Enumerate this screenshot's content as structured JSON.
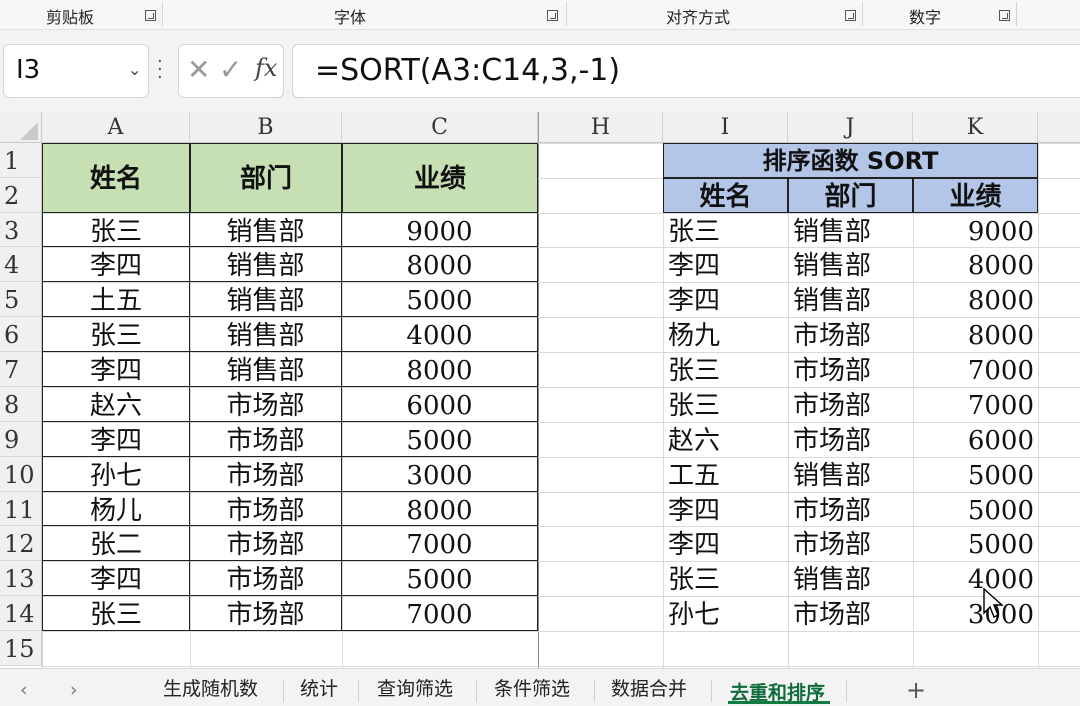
{
  "ribbon": {
    "groups": [
      "剪贴板",
      "字体",
      "对齐方式",
      "数字"
    ]
  },
  "formula_bar": {
    "name_box": "I3",
    "formula": "=SORT(A3:C14,3,-1)"
  },
  "columns": [
    "A",
    "B",
    "C",
    "H",
    "I",
    "J",
    "K"
  ],
  "rows": [
    "1",
    "2",
    "3",
    "4",
    "5",
    "6",
    "7",
    "8",
    "9",
    "10",
    "11",
    "12",
    "13",
    "14",
    "15"
  ],
  "left_table": {
    "headers": [
      "姓名",
      "部门",
      "业绩"
    ],
    "rows": [
      [
        "张三",
        "销售部",
        "9000"
      ],
      [
        "李四",
        "销售部",
        "8000"
      ],
      [
        "土五",
        "销售部",
        "5000"
      ],
      [
        "张三",
        "销售部",
        "4000"
      ],
      [
        "李四",
        "销售部",
        "8000"
      ],
      [
        "赵六",
        "市场部",
        "6000"
      ],
      [
        "李四",
        "市场部",
        "5000"
      ],
      [
        "孙七",
        "市场部",
        "3000"
      ],
      [
        "杨儿",
        "市场部",
        "8000"
      ],
      [
        "张二",
        "市场部",
        "7000"
      ],
      [
        "李四",
        "市场部",
        "5000"
      ],
      [
        "张三",
        "市场部",
        "7000"
      ]
    ]
  },
  "right_table": {
    "title": "排序函数 SORT",
    "headers": [
      "姓名",
      "部门",
      "业绩"
    ],
    "rows": [
      [
        "张三",
        "销售部",
        "9000"
      ],
      [
        "李四",
        "销售部",
        "8000"
      ],
      [
        "李四",
        "销售部",
        "8000"
      ],
      [
        "杨九",
        "市场部",
        "8000"
      ],
      [
        "张三",
        "市场部",
        "7000"
      ],
      [
        "张三",
        "市场部",
        "7000"
      ],
      [
        "赵六",
        "市场部",
        "6000"
      ],
      [
        "工五",
        "销售部",
        "5000"
      ],
      [
        "李四",
        "市场部",
        "5000"
      ],
      [
        "李四",
        "市场部",
        "5000"
      ],
      [
        "张三",
        "销售部",
        "4000"
      ],
      [
        "孙七",
        "市场部",
        "3000"
      ]
    ]
  },
  "sheet_tabs": {
    "items": [
      "生成随机数",
      "统计",
      "查询筛选",
      "条件筛选",
      "数据合并",
      "去重和排序"
    ],
    "active": "去重和排序",
    "add_label": "+"
  },
  "colors": {
    "left_header_fill": "#c6e0b4",
    "right_header_fill": "#b4c6e7",
    "active_tab": "#107c41"
  }
}
